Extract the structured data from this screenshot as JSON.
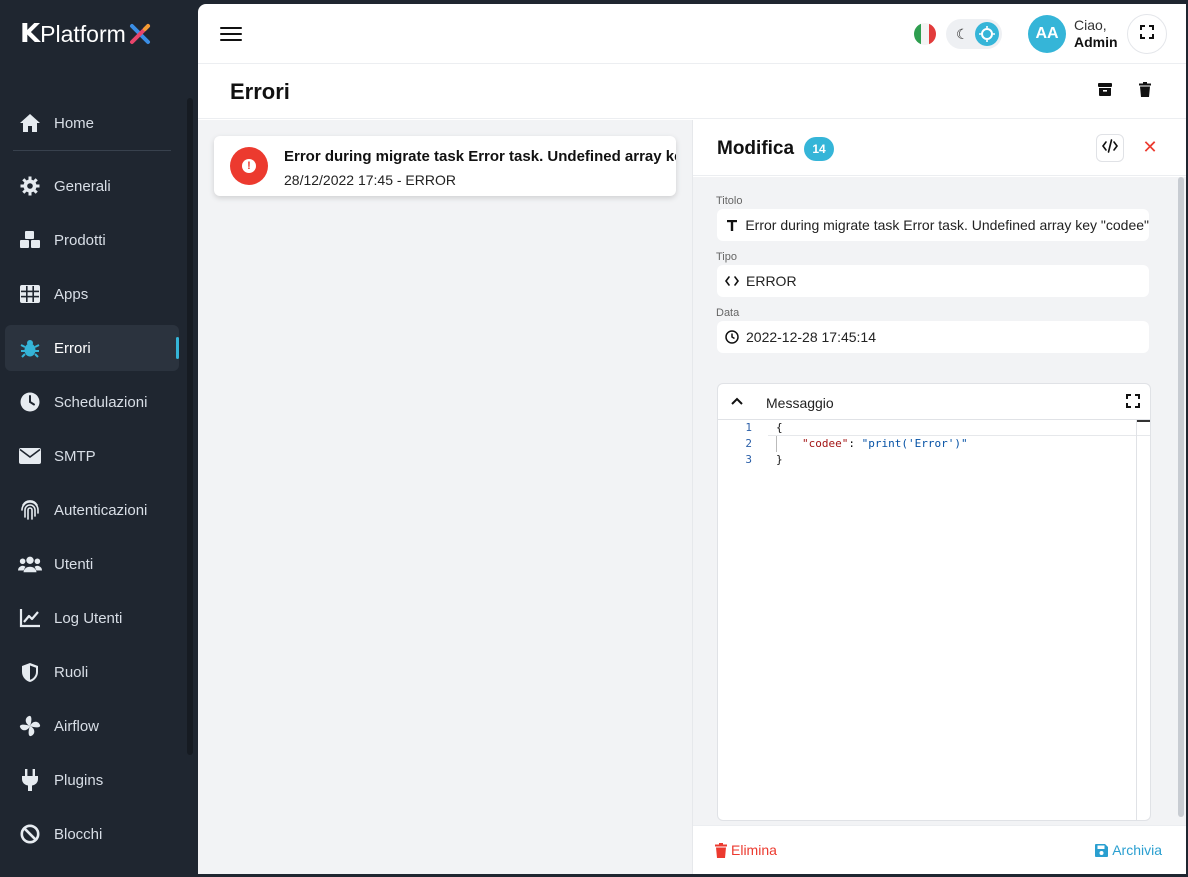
{
  "brand": {
    "logo_letter": "K",
    "logo_text": "Platform"
  },
  "nav": {
    "items": [
      {
        "label": "Home",
        "icon": "home-icon"
      },
      {
        "label": "Generali",
        "icon": "gear-icon"
      },
      {
        "label": "Prodotti",
        "icon": "cubes-icon"
      },
      {
        "label": "Apps",
        "icon": "grid-icon"
      },
      {
        "label": "Errori",
        "icon": "bug-icon",
        "active": true
      },
      {
        "label": "Schedulazioni",
        "icon": "clock-icon"
      },
      {
        "label": "SMTP",
        "icon": "envelope-icon"
      },
      {
        "label": "Autenticazioni",
        "icon": "fingerprint-icon"
      },
      {
        "label": "Utenti",
        "icon": "users-icon"
      },
      {
        "label": "Log Utenti",
        "icon": "chart-line-icon"
      },
      {
        "label": "Ruoli",
        "icon": "shield-icon"
      },
      {
        "label": "Airflow",
        "icon": "fan-icon"
      },
      {
        "label": "Plugins",
        "icon": "plug-icon"
      },
      {
        "label": "Blocchi",
        "icon": "ban-icon"
      }
    ]
  },
  "header": {
    "avatar_initials": "AA",
    "greeting": "Ciao,",
    "user_name": "Admin",
    "language_flag": "it-flag-icon"
  },
  "page": {
    "title": "Errori"
  },
  "errors": {
    "items": [
      {
        "title": "Error during migrate task Error task. Undefined array key \"codee\"",
        "subtitle": "28/12/2022 17:45 - ERROR"
      }
    ]
  },
  "detail": {
    "title": "Modifica",
    "badge": "14",
    "fields": {
      "titolo_label": "Titolo",
      "titolo_value": "Error during migrate task Error task. Undefined array key \"codee\"",
      "tipo_label": "Tipo",
      "tipo_value": "ERROR",
      "data_label": "Data",
      "data_value": "2022-12-28 17:45:14"
    },
    "editor": {
      "label": "Messaggio",
      "lines": [
        {
          "n": "1",
          "text": "{"
        },
        {
          "n": "2",
          "key": "\"codee\"",
          "sep": ": ",
          "value": "\"print('Error')\""
        },
        {
          "n": "3",
          "text": "}"
        }
      ]
    },
    "actions": {
      "delete_label": "Elimina",
      "archive_label": "Archivia"
    }
  },
  "colors": {
    "accent": "#35b5d8",
    "danger": "#ec3a2f",
    "sidebar_bg": "#1f2630"
  }
}
